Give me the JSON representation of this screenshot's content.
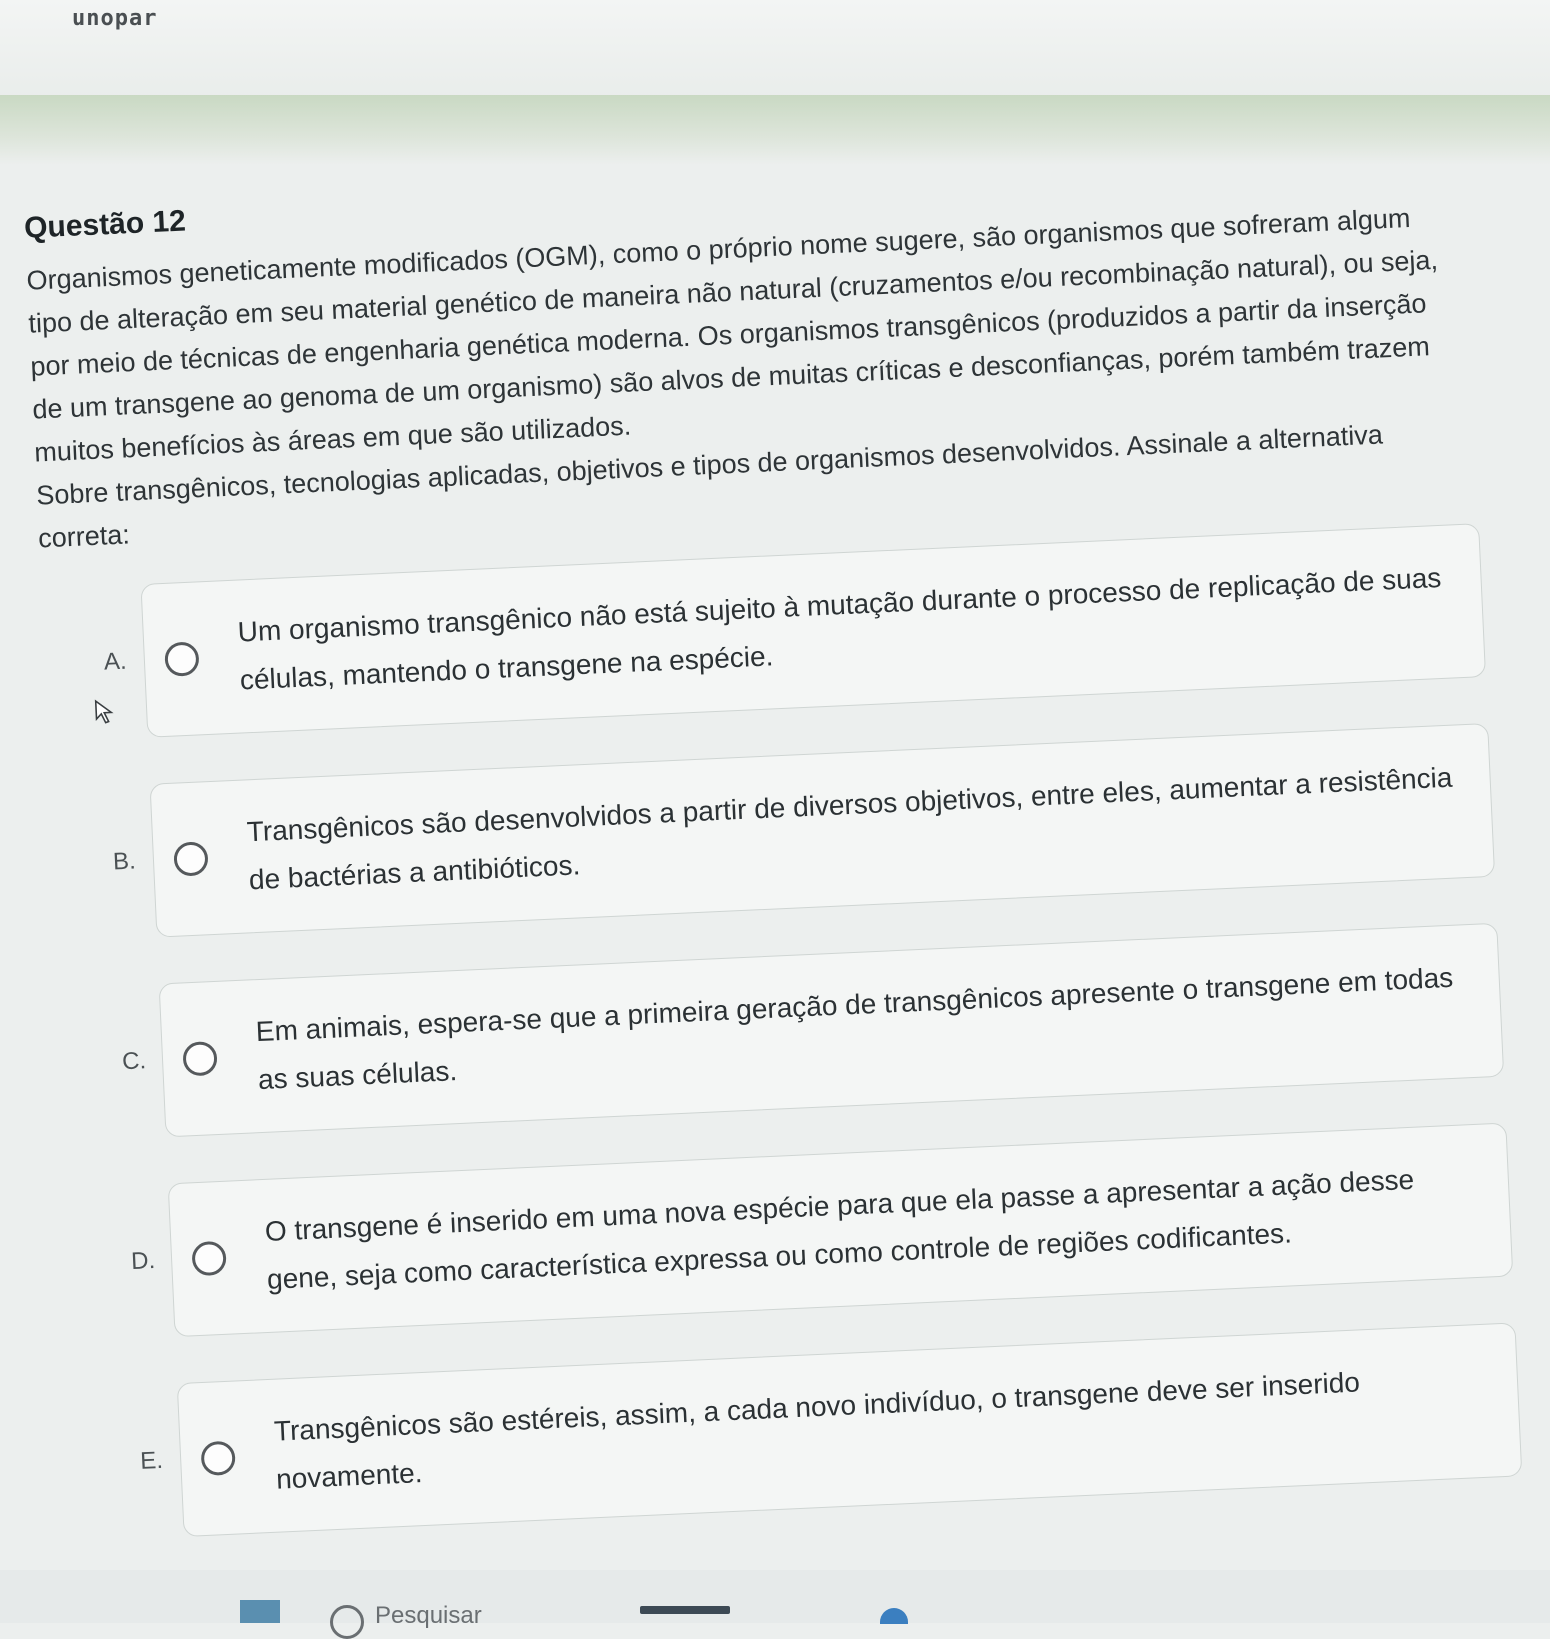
{
  "brand": "unopar",
  "question": {
    "title": "Questão 12",
    "paragraphs": [
      "Organismos geneticamente modificados (OGM), como o próprio nome sugere, são organismos que sofreram algum tipo de alteração em seu material genético de maneira não natural (cruzamentos e/ou recombinação natural), ou seja, por meio de técnicas de engenharia genética moderna. Os organismos transgênicos (produzidos a partir da inserção de um transgene ao genoma de um organismo) são alvos de muitas críticas e desconfianças, porém também trazem muitos benefícios às áreas em que são utilizados.",
      "Sobre transgênicos, tecnologias aplicadas, objetivos e tipos de organismos desenvolvidos. Assinale a alternativa correta:"
    ]
  },
  "options": [
    {
      "letter": "A.",
      "text": "Um organismo transgênico não está sujeito à mutação durante o processo de replicação de suas células, mantendo o transgene na espécie."
    },
    {
      "letter": "B.",
      "text": "Transgênicos são desenvolvidos a partir de diversos objetivos, entre eles, aumentar a resistência de bactérias a antibióticos."
    },
    {
      "letter": "C.",
      "text": "Em animais, espera-se que a primeira geração de transgênicos apresente o transgene em todas as suas células."
    },
    {
      "letter": "D.",
      "text": "O transgene é inserido em uma nova espécie para que ela passe a apresentar a ação desse gene, seja como característica expressa ou como controle de regiões codificantes."
    },
    {
      "letter": "E.",
      "text": "Transgênicos são estéreis, assim, a cada novo indivíduo, o transgene deve ser inserido novamente."
    }
  ],
  "footer": {
    "partial_label": "Pesquisar"
  }
}
